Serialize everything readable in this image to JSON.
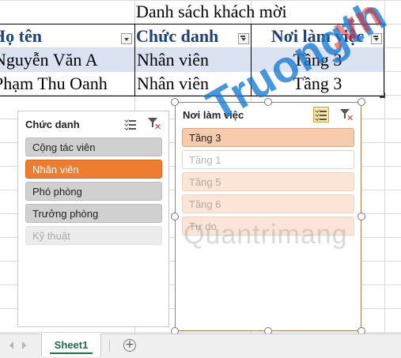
{
  "sheet": {
    "title": "Danh sách khách mời",
    "headers": [
      "Họ tên",
      "Chức danh",
      "Nơi làm việc"
    ],
    "rows": [
      [
        "Nguyễn Văn A",
        "Nhân viên",
        "Tầng 3"
      ],
      [
        "Phạm Thu Oanh",
        "Nhân viên",
        "Tầng 3"
      ]
    ]
  },
  "slicer_chuc_danh": {
    "title": "Chức danh",
    "items": [
      {
        "label": "Cộng tác viên",
        "state": "available"
      },
      {
        "label": "Nhân viên",
        "state": "selected"
      },
      {
        "label": "Phó phòng",
        "state": "available"
      },
      {
        "label": "Trưởng phòng",
        "state": "available"
      },
      {
        "label": "Kỹ thuật",
        "state": "no-data"
      }
    ],
    "multi_select_icon": "multi-select-icon",
    "clear_filter_icon": "clear-filter-icon"
  },
  "slicer_noi_lam_viec": {
    "title": "Nơi làm việc",
    "items": [
      {
        "label": "Tầng 3",
        "state": "selected"
      },
      {
        "label": "Tầng 1",
        "state": "no-data"
      },
      {
        "label": "Tầng 5",
        "state": "no-data"
      },
      {
        "label": "Tầng 6",
        "state": "no-data"
      },
      {
        "label": "Tự do",
        "state": "no-data"
      }
    ],
    "multi_select_active": true
  },
  "tabs": {
    "active_sheet": "Sheet1",
    "add_label": "+"
  },
  "watermarks": {
    "main": "Truongth",
    "main_suffix": ".vn",
    "secondary": "Quantrimang"
  },
  "colors": {
    "slicer1_selected": "#ed7d31",
    "slicer2_selected": "#f8cbad",
    "header_text": "#1f3f7a",
    "band": "#dbe3f2",
    "sheet_tab": "#1e7145"
  }
}
